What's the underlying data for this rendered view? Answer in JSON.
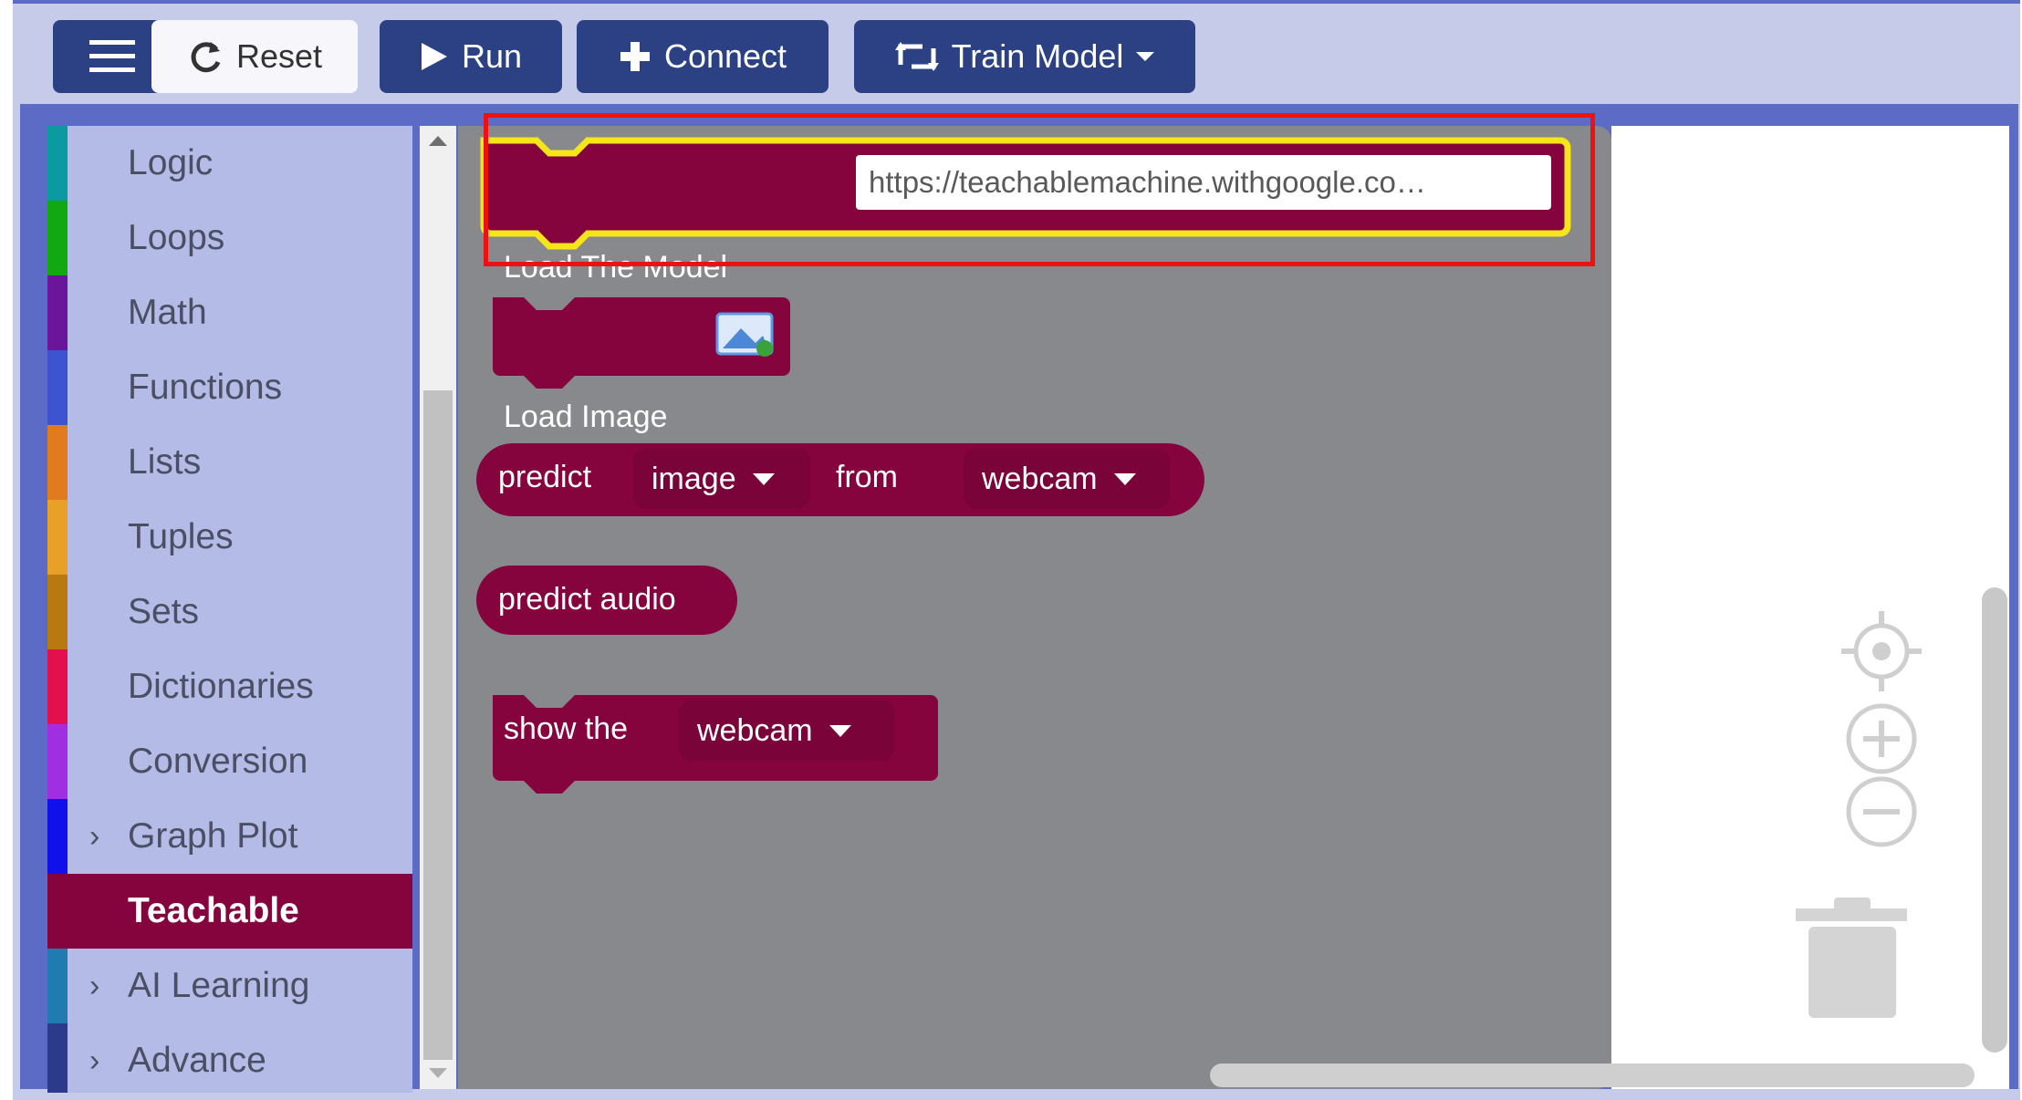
{
  "toolbar": {
    "menu_icon": "hamburger-icon",
    "reset_label": "Reset",
    "run_label": "Run",
    "connect_label": "Connect",
    "train_label": "Train Model"
  },
  "toolbox": {
    "categories": [
      {
        "label": "Logic",
        "color": "#0b9aa0",
        "expandable": false
      },
      {
        "label": "Loops",
        "color": "#11a810",
        "expandable": false
      },
      {
        "label": "Math",
        "color": "#6a169a",
        "expandable": false
      },
      {
        "label": "Functions",
        "color": "#3c55cf",
        "expandable": false
      },
      {
        "label": "Lists",
        "color": "#e07b1e",
        "expandable": false
      },
      {
        "label": "Tuples",
        "color": "#e6a126",
        "expandable": false
      },
      {
        "label": "Sets",
        "color": "#b87a10",
        "expandable": false
      },
      {
        "label": "Dictionaries",
        "color": "#e3104e",
        "expandable": false
      },
      {
        "label": "Conversion",
        "color": "#9f2fe0",
        "expandable": false
      },
      {
        "label": "Graph Plot",
        "color": "#1010e8",
        "expandable": true
      },
      {
        "label": "Teachable",
        "color": "#85043e",
        "expandable": false,
        "selected": true
      },
      {
        "label": "AI Learning",
        "color": "#1f7bb0",
        "expandable": true
      },
      {
        "label": "Advance",
        "color": "#2b3a8a",
        "expandable": true
      }
    ]
  },
  "blocks": {
    "block_color": "#85043e",
    "load_model_label": "Load The Model",
    "load_model_url": "https://teachablemachine.withgoogle.co…",
    "load_image_label": "Load Image",
    "predict_label": "predict",
    "predict_source_value": "image",
    "from_label": "from",
    "predict_device_value": "webcam",
    "predict_audio_label": "predict audio",
    "show_label": "show the",
    "show_device_value": "webcam"
  },
  "highlight_color": "#ee1111",
  "workspace_icons": [
    "recenter-icon",
    "zoom-in-icon",
    "zoom-out-icon",
    "trash-icon"
  ]
}
